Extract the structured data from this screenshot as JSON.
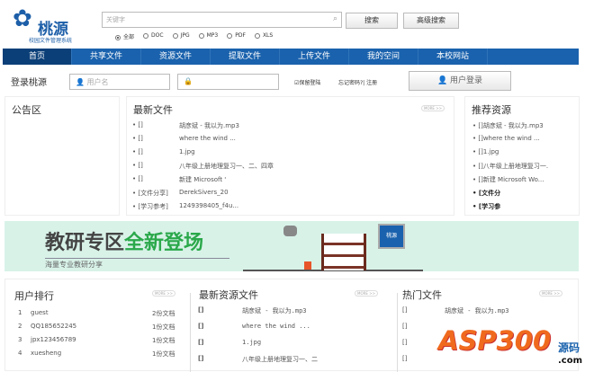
{
  "logo": {
    "name": "桃源",
    "subtitle": "校园文件管理系统"
  },
  "search": {
    "placeholder": "关键字",
    "search_label": "搜索",
    "advanced_label": "高级搜索",
    "filters": [
      {
        "label": "全部",
        "selected": true
      },
      {
        "label": "DOC",
        "selected": false
      },
      {
        "label": "JPG",
        "selected": false
      },
      {
        "label": "MP3",
        "selected": false
      },
      {
        "label": "PDF",
        "selected": false
      },
      {
        "label": "XLS",
        "selected": false
      }
    ]
  },
  "nav": [
    "首页",
    "共享文件",
    "资源文件",
    "提取文件",
    "上传文件",
    "我的空间",
    "本校网站"
  ],
  "login": {
    "title": "登录桃源",
    "username_placeholder": "用户名",
    "remember_label": "保留登陆",
    "forgot_label": "忘记密码?| 注册",
    "login_label": "用户登录"
  },
  "notice": {
    "title": "公告区"
  },
  "latest": {
    "title": "最新文件",
    "more": "MORE >>",
    "items": [
      {
        "tag": "[]",
        "name": "胡彦斌 - 我以为.mp3"
      },
      {
        "tag": "[]",
        "name": "where the wind ..."
      },
      {
        "tag": "[]",
        "name": "1.jpg"
      },
      {
        "tag": "[]",
        "name": "八年级上册地理复习一、二、四章"
      },
      {
        "tag": "[]",
        "name": "新建 Microsoft '"
      },
      {
        "tag": "[文件分享]",
        "name": "DerekSivers_20"
      },
      {
        "tag": "[学习参考]",
        "name": "1249398405_f4u..."
      }
    ]
  },
  "recommend": {
    "title": "推荐资源",
    "items": [
      "[]胡彦斌 - 我以为.mp3",
      "[]where the wind ...",
      "[]1.jpg",
      "[]八年级上册地理复习一.",
      "[]新建 Microsoft Wo...",
      "[文件分",
      "[学习参"
    ]
  },
  "banner": {
    "title_a": "教研专区",
    "title_b": "全新登场",
    "subtitle": "海量专业教研分享",
    "badge": "桃源"
  },
  "ranking": {
    "title": "用户排行",
    "more": "MORE >>",
    "items": [
      {
        "rank": "1",
        "user": "guest",
        "count": "2份文档"
      },
      {
        "rank": "2",
        "user": "QQ185652245",
        "count": "1份文档"
      },
      {
        "rank": "3",
        "user": "jpx123456789",
        "count": "1份文档"
      },
      {
        "rank": "4",
        "user": "xuesheng",
        "count": "1份文档"
      }
    ]
  },
  "latest_res": {
    "title": "最新资源文件",
    "more": "MORE >>",
    "items": [
      {
        "tag": "[]",
        "name": "胡彦斌 - 我以为.mp3"
      },
      {
        "tag": "[]",
        "name": "where the wind ..."
      },
      {
        "tag": "[]",
        "name": "1.jpg"
      },
      {
        "tag": "[]",
        "name": "八年级上册地理复习一、二"
      }
    ]
  },
  "hot": {
    "title": "热门文件",
    "more": "MORE >>",
    "items": [
      {
        "tag": "[]",
        "name": "胡彦斌 - 我以为.mp3"
      },
      {
        "tag": "[]",
        "name": ""
      },
      {
        "tag": "[]",
        "name": ""
      },
      {
        "tag": "[]",
        "name": ""
      }
    ]
  },
  "watermark": {
    "text": "ASP300",
    "sub": "源码",
    "domain": ".com"
  },
  "colors": {
    "nav": "#1a62ad",
    "nav_active": "#0b3f78",
    "banner_bg": "#d8f2e8",
    "green": "#2aa84a"
  }
}
